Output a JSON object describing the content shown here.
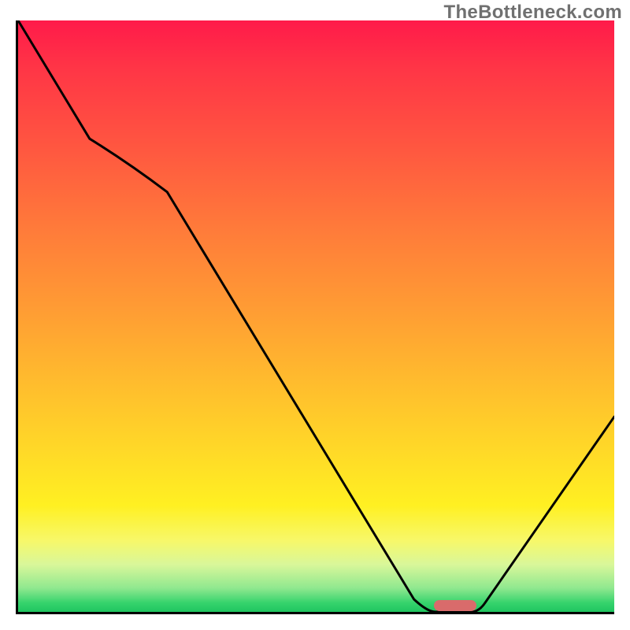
{
  "watermark": "TheBottleneck.com",
  "colors": {
    "gradient_top": "#ff1a4a",
    "gradient_bottom": "#20c560",
    "curve": "#000000",
    "marker": "#d96b6b",
    "axis": "#000000"
  },
  "chart_data": {
    "type": "line",
    "title": "",
    "xlabel": "",
    "ylabel": "",
    "xlim": [
      0,
      100
    ],
    "ylim": [
      0,
      100
    ],
    "x": [
      0,
      12,
      25,
      70,
      76,
      100
    ],
    "values": [
      100,
      80,
      71,
      0,
      0,
      33
    ],
    "marker": {
      "x_start": 70,
      "x_end": 76,
      "y": 0
    },
    "note": "x and y are read as percentages of the plot area; the curve descends from top-left, has a knee near x≈25, reaches the baseline around x≈70–76 (flat minimum, red pill marker), then rises to ≈33% height at the right edge."
  }
}
